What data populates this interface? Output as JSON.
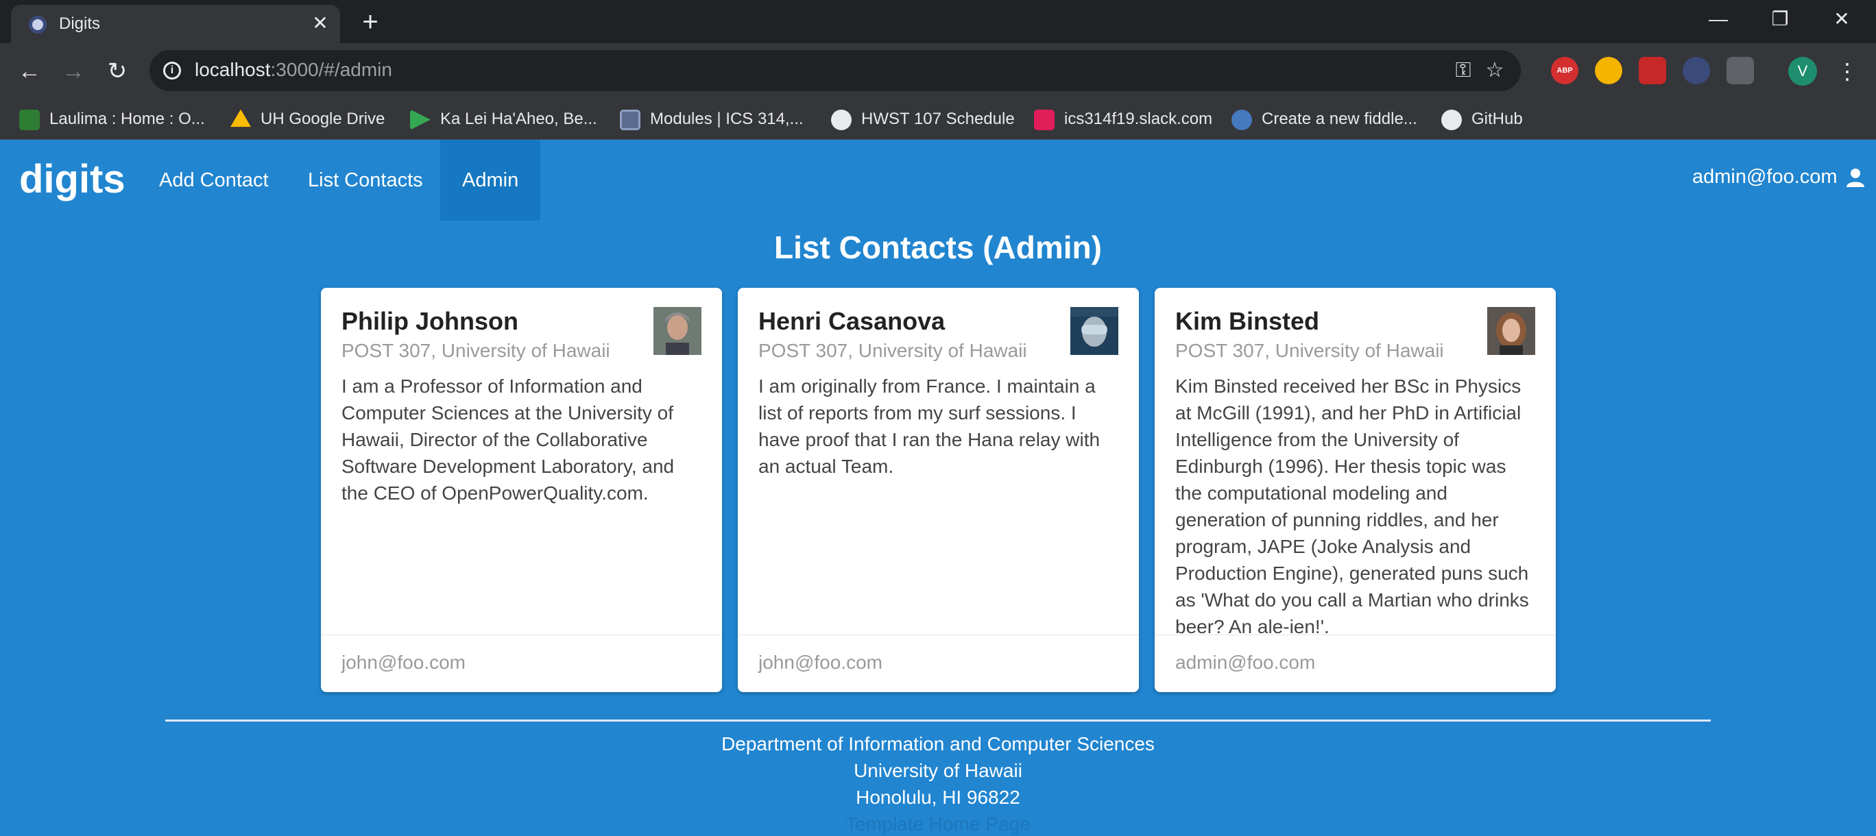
{
  "browser": {
    "tab_title": "Digits",
    "url_host": "localhost",
    "url_rest": ":3000/#/admin",
    "bookmarks": [
      {
        "label": "Laulima : Home : O...",
        "icon": "laulima-icon",
        "color": "#2e7d32"
      },
      {
        "label": "UH Google Drive",
        "icon": "google-drive-icon",
        "color": "#fbbc04"
      },
      {
        "label": "Ka Lei Ha'Aheo, Be...",
        "icon": "google-play-icon",
        "color": "#34a853"
      },
      {
        "label": "Modules | ICS 314,...",
        "icon": "modules-icon",
        "color": "#5b6c8f"
      },
      {
        "label": "HWST 107 Schedule",
        "icon": "globe-icon",
        "color": "#e8eaed"
      },
      {
        "label": "ics314f19.slack.com",
        "icon": "slack-icon",
        "color": "#e01e5a"
      },
      {
        "label": "Create a new fiddle...",
        "icon": "jsfiddle-icon",
        "color": "#4679bd"
      },
      {
        "label": "GitHub",
        "icon": "github-icon",
        "color": "#e8eaed"
      }
    ],
    "profile_initial": "V",
    "adblock_label": "ABP"
  },
  "app": {
    "brand": "digits",
    "nav": {
      "add_contact": "Add Contact",
      "list_contacts": "List Contacts",
      "admin": "Admin"
    },
    "user": "admin@foo.com"
  },
  "page": {
    "title": "List Contacts (Admin)"
  },
  "contacts": [
    {
      "name": "Philip Johnson",
      "address": "POST 307, University of Hawaii",
      "description": "I am a Professor of Information and Computer Sciences at the University of Hawaii, Director of the Collaborative Software Development Laboratory, and the CEO of OpenPowerQuality.com.",
      "owner": "john@foo.com"
    },
    {
      "name": "Henri Casanova",
      "address": "POST 307, University of Hawaii",
      "description": "I am originally from France. I maintain a list of reports from my surf sessions. I have proof that I ran the Hana relay with an actual Team.",
      "owner": "john@foo.com"
    },
    {
      "name": "Kim Binsted",
      "address": "POST 307, University of Hawaii",
      "description": "Kim Binsted received her BSc in Physics at McGill (1991), and her PhD in Artificial Intelligence from the University of Edinburgh (1996). Her thesis topic was the computational modeling and generation of punning riddles, and her program, JAPE (Joke Analysis and Production Engine), generated puns such as 'What do you call a Martian who drinks beer? An ale-ien!'.",
      "owner": "admin@foo.com"
    }
  ],
  "footer": {
    "line1": "Department of Information and Computer Sciences",
    "line2": "University of Hawaii",
    "line3": "Honolulu, HI 96822",
    "line4": "Template Home Page"
  },
  "colors": {
    "page_bg": "#2185d0",
    "active_menu": "#1678c2"
  }
}
